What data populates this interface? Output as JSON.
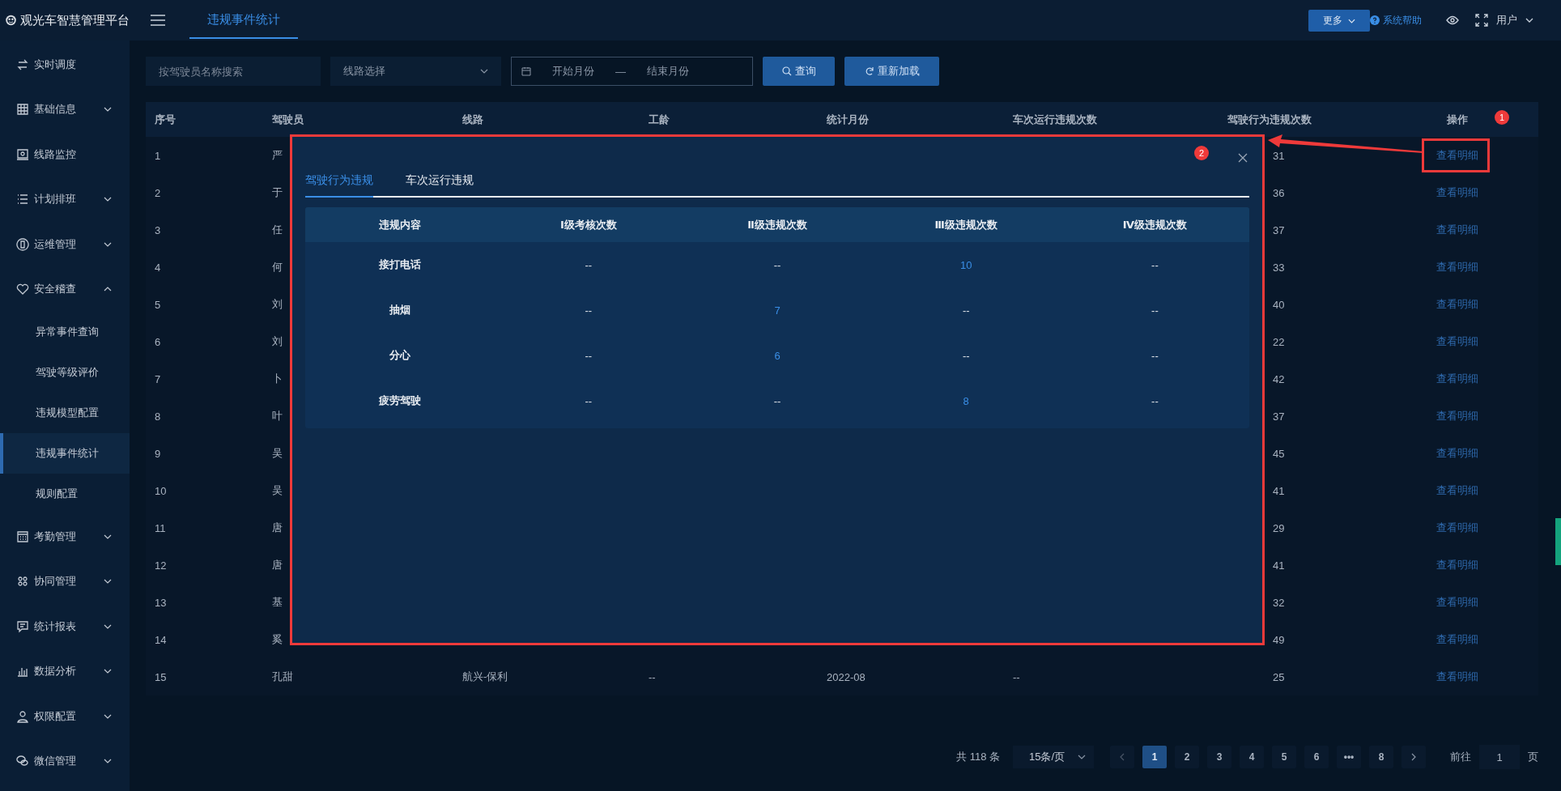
{
  "app": {
    "title": "观光车智慧管理平台"
  },
  "page_tabs": [
    {
      "label": "违规事件统计",
      "selected": true
    }
  ],
  "header_actions": {
    "more": "更多",
    "help": "系统帮助",
    "user": "用户"
  },
  "sidebar": {
    "items": [
      {
        "label": "实时调度",
        "kind": "link"
      },
      {
        "label": "基础信息",
        "kind": "group",
        "expanded": false
      },
      {
        "label": "线路监控",
        "kind": "link"
      },
      {
        "label": "计划排班",
        "kind": "group",
        "expanded": false
      },
      {
        "label": "运维管理",
        "kind": "group",
        "expanded": false
      },
      {
        "label": "安全稽查",
        "kind": "group",
        "expanded": true,
        "children": [
          {
            "label": "异常事件查询",
            "selected": false
          },
          {
            "label": "驾驶等级评价",
            "selected": false
          },
          {
            "label": "违规模型配置",
            "selected": false
          },
          {
            "label": "违规事件统计",
            "selected": true
          },
          {
            "label": "规则配置",
            "selected": false
          }
        ]
      },
      {
        "label": "考勤管理",
        "kind": "group",
        "expanded": false
      },
      {
        "label": "协同管理",
        "kind": "group",
        "expanded": false
      },
      {
        "label": "统计报表",
        "kind": "group",
        "expanded": false
      },
      {
        "label": "数据分析",
        "kind": "group",
        "expanded": false
      },
      {
        "label": "权限配置",
        "kind": "group",
        "expanded": false
      },
      {
        "label": "微信管理",
        "kind": "group",
        "expanded": false
      }
    ]
  },
  "filters": {
    "driver_search": {
      "placeholder": "按驾驶员名称搜索"
    },
    "route_select": {
      "placeholder": "线路选择"
    },
    "month_range": {
      "start_placeholder": "开始月份",
      "separator": "—",
      "end_placeholder": "结束月份"
    },
    "buttons": [
      "查询",
      "重新加载"
    ]
  },
  "table": {
    "columns": [
      "序号",
      "驾驶员",
      "线路",
      "工龄",
      "统计月份",
      "车次运行违规次数",
      "驾驶行为违规次数",
      "操作"
    ],
    "rows": [
      {
        "no": "1",
        "driver": "严",
        "behavior_violations": "31",
        "action": "查看明细"
      },
      {
        "no": "2",
        "driver": "于",
        "behavior_violations": "36",
        "action": "查看明细"
      },
      {
        "no": "3",
        "driver": "任",
        "behavior_violations": "37",
        "action": "查看明细"
      },
      {
        "no": "4",
        "driver": "何",
        "behavior_violations": "33",
        "action": "查看明细"
      },
      {
        "no": "5",
        "driver": "刘",
        "behavior_violations": "40",
        "action": "查看明细"
      },
      {
        "no": "6",
        "driver": "刘",
        "behavior_violations": "22",
        "action": "查看明细"
      },
      {
        "no": "7",
        "driver": "卜",
        "behavior_violations": "42",
        "action": "查看明细"
      },
      {
        "no": "8",
        "driver": "叶",
        "behavior_violations": "37",
        "action": "查看明细"
      },
      {
        "no": "9",
        "driver": "吴",
        "behavior_violations": "45",
        "action": "查看明细"
      },
      {
        "no": "10",
        "driver": "吴",
        "behavior_violations": "41",
        "action": "查看明细"
      },
      {
        "no": "11",
        "driver": "唐",
        "behavior_violations": "29",
        "action": "查看明细"
      },
      {
        "no": "12",
        "driver": "唐",
        "behavior_violations": "41",
        "action": "查看明细"
      },
      {
        "no": "13",
        "driver": "基",
        "behavior_violations": "32",
        "action": "查看明细"
      },
      {
        "no": "14",
        "driver": "奚",
        "behavior_violations": "49",
        "action": "查看明细"
      },
      {
        "no": "15",
        "driver": "孔甜",
        "line": "航兴-保利",
        "tenure": "--",
        "month": "2022-08",
        "trip_violations": "--",
        "behavior_violations": "25",
        "action": "查看明细"
      }
    ]
  },
  "pagination": {
    "total": "共 118 条",
    "page_size": "15条/页",
    "pages": [
      {
        "label": "1",
        "selected": true
      },
      {
        "label": "2",
        "selected": false
      },
      {
        "label": "3",
        "selected": false
      },
      {
        "label": "4",
        "selected": false
      },
      {
        "label": "5",
        "selected": false
      },
      {
        "label": "6",
        "selected": false
      },
      {
        "label": "•••",
        "selected": false
      },
      {
        "label": "8",
        "selected": false
      }
    ],
    "goto_label": "前往",
    "goto_value": "1",
    "goto_suffix": "页"
  },
  "dialog": {
    "tabs": [
      {
        "label": "驾驶行为违规",
        "selected": true
      },
      {
        "label": "车次运行违规",
        "selected": false
      }
    ],
    "columns": [
      "违规内容",
      "Ⅰ级考核次数",
      "Ⅱ级违规次数",
      "Ⅲ级违规次数",
      "Ⅳ级违规次数"
    ],
    "rows": [
      {
        "cells": [
          {
            "text": "接打电话",
            "highlighted": false
          },
          {
            "text": "--",
            "highlighted": false
          },
          {
            "text": "--",
            "highlighted": false
          },
          {
            "text": "10",
            "highlighted": true
          },
          {
            "text": "--",
            "highlighted": false
          }
        ]
      },
      {
        "cells": [
          {
            "text": "抽烟",
            "highlighted": false
          },
          {
            "text": "--",
            "highlighted": false
          },
          {
            "text": "7",
            "highlighted": true
          },
          {
            "text": "--",
            "highlighted": false
          },
          {
            "text": "--",
            "highlighted": false
          }
        ]
      },
      {
        "cells": [
          {
            "text": "分心",
            "highlighted": false
          },
          {
            "text": "--",
            "highlighted": false
          },
          {
            "text": "6",
            "highlighted": true
          },
          {
            "text": "--",
            "highlighted": false
          },
          {
            "text": "--",
            "highlighted": false
          }
        ]
      },
      {
        "cells": [
          {
            "text": "疲劳驾驶",
            "highlighted": false
          },
          {
            "text": "--",
            "highlighted": false
          },
          {
            "text": "--",
            "highlighted": false
          },
          {
            "text": "8",
            "highlighted": true
          },
          {
            "text": "--",
            "highlighted": false
          }
        ]
      }
    ]
  },
  "annotations": {
    "badges": [
      "1",
      "2"
    ]
  }
}
